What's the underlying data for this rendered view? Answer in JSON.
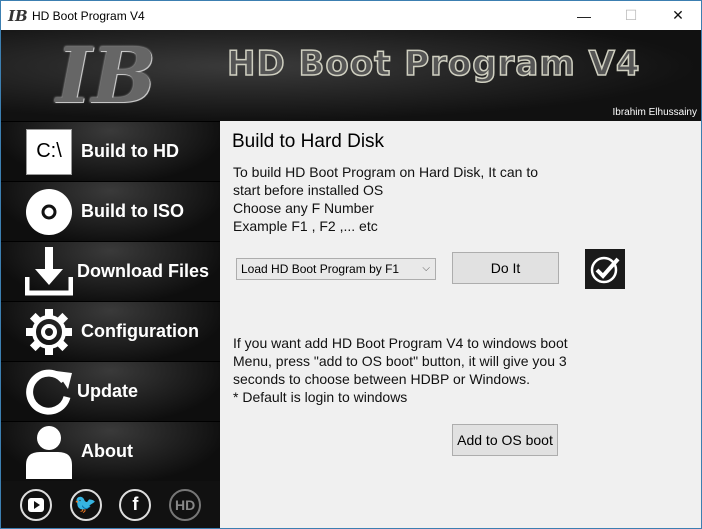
{
  "window": {
    "title": "HD Boot Program V4",
    "app_icon": "IB",
    "minimize": "—",
    "maximize": "☐",
    "close": "✕"
  },
  "header": {
    "logo": "IB",
    "banner": "HD Boot Program V4",
    "author": "Ibrahim Elhussainy"
  },
  "sidebar": {
    "items": [
      {
        "label": "Build to HD",
        "icon": "drive-icon"
      },
      {
        "label": "Build to ISO",
        "icon": "disc-icon"
      },
      {
        "label": "Download Files",
        "icon": "download-icon"
      },
      {
        "label": "Configuration",
        "icon": "gear-icon"
      },
      {
        "label": "Update",
        "icon": "refresh-icon"
      },
      {
        "label": "About",
        "icon": "user-icon"
      }
    ],
    "drive_text": "C:\\",
    "social": [
      "youtube",
      "twitter",
      "facebook",
      "hd"
    ]
  },
  "content": {
    "title": "Build to Hard Disk",
    "desc": [
      "To build HD Boot Program on Hard Disk, It can to",
      "start before installed OS",
      "Choose any F Number",
      "Example F1 , F2 ,... etc"
    ],
    "select_value": "Load HD Boot Program by F1",
    "do_it": "Do It",
    "info": [
      "If you want add HD Boot Program V4 to windows boot",
      "Menu, press \"add to OS boot\" button, it will give you 3",
      "seconds to choose between HDBP or Windows.",
      "* Default is login to windows"
    ],
    "add_os_boot": "Add to OS boot"
  }
}
